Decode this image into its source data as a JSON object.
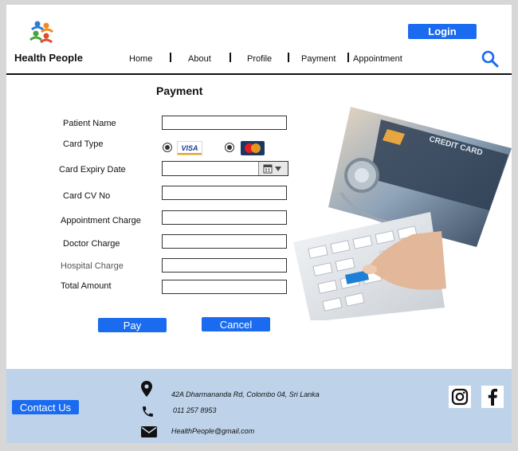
{
  "brand": {
    "name": "Health People"
  },
  "header": {
    "login_label": "Login"
  },
  "nav": {
    "items": [
      "Home",
      "About",
      "Profile",
      "Payment",
      "Appointment"
    ]
  },
  "page": {
    "title": "Payment"
  },
  "form": {
    "labels": {
      "patient_name": "Patient Name",
      "card_type": "Card Type",
      "card_expiry": "Card Expiry Date",
      "card_cv": "Card CV No",
      "appointment_charge": "Appointment Charge",
      "doctor_charge": "Doctor Charge",
      "hospital_charge": "Hospital Charge",
      "total_amount": "Total Amount"
    },
    "values": {
      "patient_name": "",
      "card_expiry": "",
      "card_cv": "",
      "appointment_charge": "",
      "doctor_charge": "",
      "hospital_charge": "",
      "total_amount": ""
    },
    "card_options": {
      "visa": "VISA"
    },
    "pay_label": "Pay",
    "cancel_label": "Cancel"
  },
  "footer": {
    "contact_label": "Contact Us",
    "address": "42A Dharmananda Rd, Colombo 04, Sri Lanka",
    "phone": "011 257 8953",
    "email": "HealthPeople@gmail.com"
  },
  "colors": {
    "accent": "#1a6bf0",
    "footer_bg": "#bed3ea"
  },
  "icons": {
    "logo": "people-logo-icon",
    "search": "search-icon",
    "calendar": "calendar-icon",
    "location": "location-pin-icon",
    "phone": "phone-icon",
    "email": "envelope-icon",
    "instagram": "instagram-icon",
    "facebook": "facebook-icon"
  }
}
